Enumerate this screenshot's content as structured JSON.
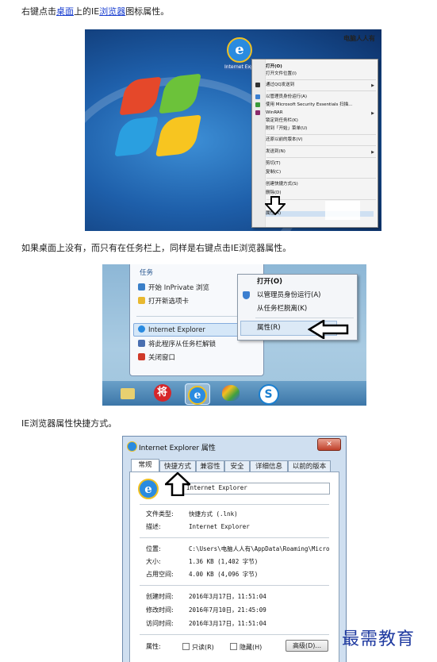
{
  "paragraphs": {
    "p1_a": "右键点击",
    "p1_link1": "桌面",
    "p1_b": "上的IE",
    "p1_link2": "浏览器",
    "p1_c": "图标属性。",
    "p2": "如果桌面上没有，而只有在任务栏上，同样是右键点击IE浏览器属性。",
    "p3": "IE浏览器属性快捷方式。"
  },
  "fig1": {
    "watermark": "电脑人人有",
    "icon_caption": "Internet Explorer",
    "menu": [
      "打开(O)",
      "打开文件位置(I)",
      "通过QQ发送到",
      "以管理员身份运行(A)",
      "使用 Microsoft Security Essentials 扫描...",
      "WinRAR",
      "锁定到任务栏(K)",
      "附到「开始」菜单(U)",
      "还原以前的版本(V)",
      "发送到(N)",
      "剪切(T)",
      "复制(C)",
      "创建快捷方式(S)",
      "删除(D)",
      "属性(R)"
    ]
  },
  "fig2": {
    "jump_header": "任务",
    "jump_items": [
      "开始 InPrivate 浏览",
      "打开新选项卡"
    ],
    "jump_selected": "Internet Explorer",
    "jump_bottom": [
      "将此程序从任务栏解锁",
      "关闭窗口"
    ],
    "menu": [
      "打开(O)",
      "以管理员身份运行(A)",
      "从任务栏脱离(K)",
      "属性(R)"
    ]
  },
  "fig3": {
    "title": "Internet Explorer 属性",
    "close": "✕",
    "tabs": [
      "常规",
      "快捷方式",
      "兼容性",
      "安全",
      "详细信息",
      "以前的版本"
    ],
    "name_value": "Internet Explorer",
    "rows": [
      {
        "label": "文件类型:",
        "value": "快捷方式 (.lnk)"
      },
      {
        "label": "描述:",
        "value": "Internet Explorer"
      },
      {
        "label": "位置:",
        "value": "C:\\Users\\电脑人人有\\AppData\\Roaming\\Micro"
      },
      {
        "label": "大小:",
        "value": "1.36 KB (1,402 字节)"
      },
      {
        "label": "占用空间:",
        "value": "4.00 KB (4,096 字节)"
      },
      {
        "label": "创建时间:",
        "value": "2016年3月17日，11:51:04"
      },
      {
        "label": "修改时间:",
        "value": "2016年7月10日，21:45:09"
      },
      {
        "label": "访问时间:",
        "value": "2016年3月17日，11:51:04"
      }
    ],
    "attr_label": "属性:",
    "readonly": "只读(R)",
    "hidden": "隐藏(H)",
    "advanced": "高级(D)..."
  },
  "watermark": "最需教育",
  "colors": {
    "link": "#1a3fd0",
    "watermark": "#1f3aa0"
  }
}
